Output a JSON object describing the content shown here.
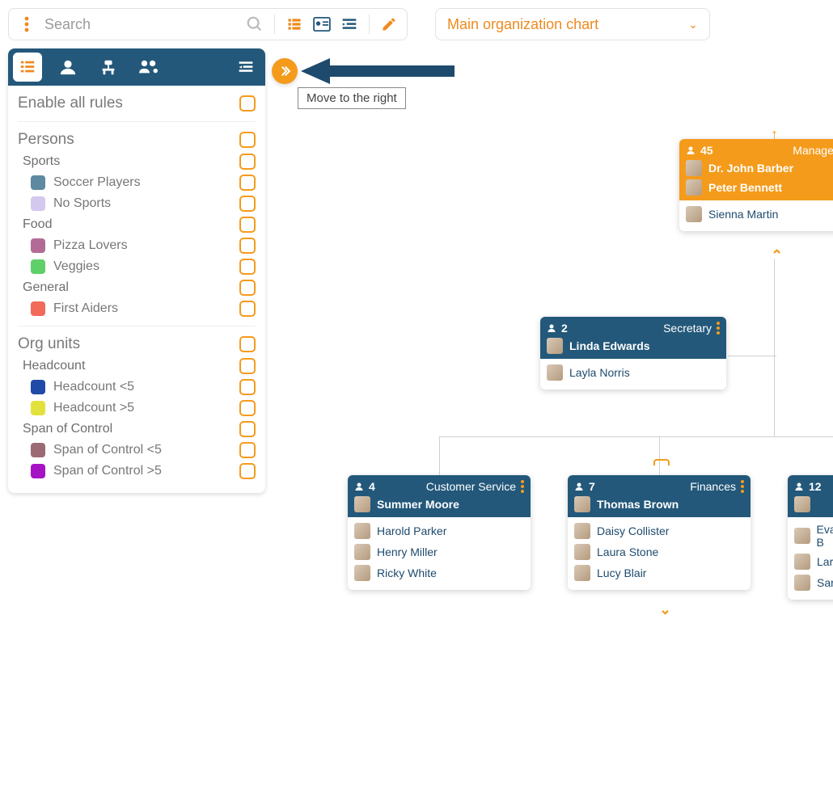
{
  "topbar": {
    "search_placeholder": "Search",
    "dropdown_selected": "Main organization chart"
  },
  "tooltip": "Move to the right",
  "sidebar": {
    "enable_all": "Enable all rules",
    "persons": {
      "title": "Persons",
      "groups": [
        {
          "title": "Sports",
          "items": [
            {
              "label": "Soccer Players",
              "color": "#5d89a1"
            },
            {
              "label": "No Sports",
              "color": "#d3c9ef"
            }
          ]
        },
        {
          "title": "Food",
          "items": [
            {
              "label": "Pizza Lovers",
              "color": "#b36b96"
            },
            {
              "label": "Veggies",
              "color": "#5fcf6a"
            }
          ]
        },
        {
          "title": "General",
          "items": [
            {
              "label": "First Aiders",
              "color": "#f26a5a"
            }
          ]
        }
      ]
    },
    "orgunits": {
      "title": "Org units",
      "groups": [
        {
          "title": "Headcount",
          "items": [
            {
              "label": "Headcount <5",
              "color": "#1f4aa8"
            },
            {
              "label": "Headcount >5",
              "color": "#e3e23d"
            }
          ]
        },
        {
          "title": "Span of Control",
          "items": [
            {
              "label": "Span of Control <5",
              "color": "#9c6a74"
            },
            {
              "label": "Span of Control >5",
              "color": "#a513c4"
            }
          ]
        }
      ]
    }
  },
  "nodes": {
    "mgmt": {
      "count": "45",
      "role": "Management",
      "managers": [
        "Dr. John Barber",
        "Peter Bennett"
      ],
      "staff": [
        "Sienna Martin"
      ]
    },
    "sec": {
      "count": "2",
      "role": "Secretary",
      "managers": [
        "Linda Edwards"
      ],
      "staff": [
        "Layla Norris"
      ]
    },
    "cs": {
      "count": "4",
      "role": "Customer Service",
      "managers": [
        "Summer Moore"
      ],
      "staff": [
        "Harold Parker",
        "Henry Miller",
        "Ricky White"
      ]
    },
    "fin": {
      "count": "7",
      "role": "Finances",
      "managers": [
        "Thomas Brown"
      ],
      "staff": [
        "Daisy Collister",
        "Laura Stone",
        "Lucy Blair"
      ]
    },
    "right": {
      "count": "12",
      "staff": [
        "Eva B",
        "Larry",
        "Sara"
      ]
    }
  }
}
